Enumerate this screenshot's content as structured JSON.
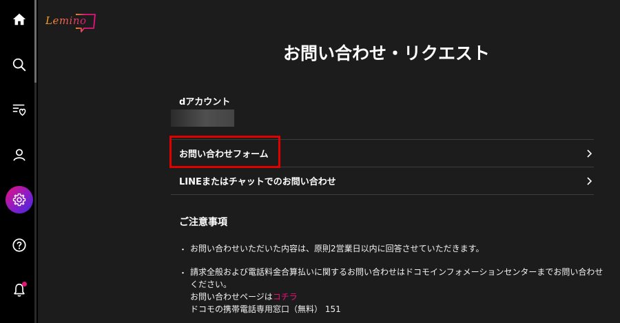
{
  "app": {
    "logo_text": "Lemino"
  },
  "colors": {
    "accent": "#e8127c",
    "highlight": "#e00000",
    "background": "#1c1c1c",
    "sidebar": "#000000"
  },
  "sidebar": {
    "items": [
      {
        "name": "home",
        "icon": "home-icon"
      },
      {
        "name": "search",
        "icon": "search-icon"
      },
      {
        "name": "my-list",
        "icon": "favorites-list-icon"
      },
      {
        "name": "account",
        "icon": "user-icon"
      },
      {
        "name": "settings",
        "icon": "gear-icon",
        "active": true
      },
      {
        "name": "help",
        "icon": "help-icon"
      },
      {
        "name": "notifications",
        "icon": "bell-icon",
        "has_badge": true
      }
    ]
  },
  "page": {
    "title": "お問い合わせ・リクエスト"
  },
  "account": {
    "label": "dアカウント"
  },
  "menu": {
    "items": [
      {
        "label": "お問い合わせフォーム"
      },
      {
        "label": "LINEまたはチャットでのお問い合わせ"
      }
    ]
  },
  "notes": {
    "heading": "ご注意事項",
    "bullet": "・",
    "item1": "お問い合わせいただいた内容は、原則2営業日以内に回答させていただきます。",
    "item2_line1": "請求全般および電話料金合算払いに関するお問い合わせはドコモインフォメーションセンターまでお問い合わせ",
    "item2_line2": "ください。",
    "item2_page_prefix": "お問い合わせページは",
    "item2_link": "コチラ",
    "item2_phone": "ドコモの携帯電話専用窓口（無料） 151"
  }
}
